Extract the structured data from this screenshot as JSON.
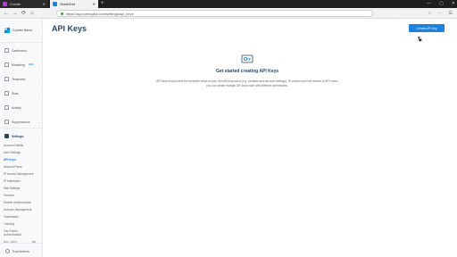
{
  "browser": {
    "tabs": [
      {
        "label": "Create",
        "favicon_color": "#b53fd0"
      },
      {
        "label": "SendGrid",
        "favicon_color": "#1a82e2"
      }
    ],
    "new_tab": "+",
    "window_controls": [
      "—",
      "▢",
      "✕"
    ],
    "url": "https://app.sendgrid.com/settings/api_keys",
    "nav": {
      "back": "←",
      "forward": "→",
      "reload": "⟳",
      "home": "⌂"
    },
    "toolbar_icons": [
      "☆",
      "⋯",
      "☰"
    ]
  },
  "sidebar": {
    "account_name": "Courier Demo",
    "account_caret": "⌄",
    "items": [
      {
        "label": "Dashboard",
        "name": "dashboard"
      },
      {
        "label": "Marketing",
        "badge": "NEW",
        "caret": "⌄",
        "name": "marketing"
      },
      {
        "label": "Templates",
        "caret": "⌄",
        "name": "templates"
      },
      {
        "label": "Stats",
        "caret": "⌄",
        "name": "stats"
      },
      {
        "label": "Activity",
        "name": "activity"
      },
      {
        "label": "Suppressions",
        "caret": "⌄",
        "name": "suppressions"
      },
      {
        "label": "Settings",
        "caret": "⌃",
        "name": "settings"
      }
    ],
    "settings_subitems": [
      "Account Details",
      "Alert Settings",
      "API Keys",
      "Inbound Parse",
      "IP Access Management",
      "IP Addresses",
      "Mail Settings",
      "Partners",
      "Sender Authentication",
      "Subuser Management",
      "Teammates",
      "Tracking",
      "Two-Factor Authentication"
    ],
    "current_subitem": "API Keys",
    "usage_label": "MAIL SENT",
    "usage_value": "0%",
    "experiments_label": "Experiments"
  },
  "main": {
    "title": "API Keys",
    "create_button": "Create API Key",
    "empty_title": "Get started creating API Keys",
    "empty_desc": "API keys help protect the sensitive areas of your SendGrid account (e.g. contacts and account settings). To control and limit access to API users, you can create multiple API keys each with different permissions."
  },
  "colors": {
    "accent": "#1a82e2",
    "title": "#294661"
  }
}
